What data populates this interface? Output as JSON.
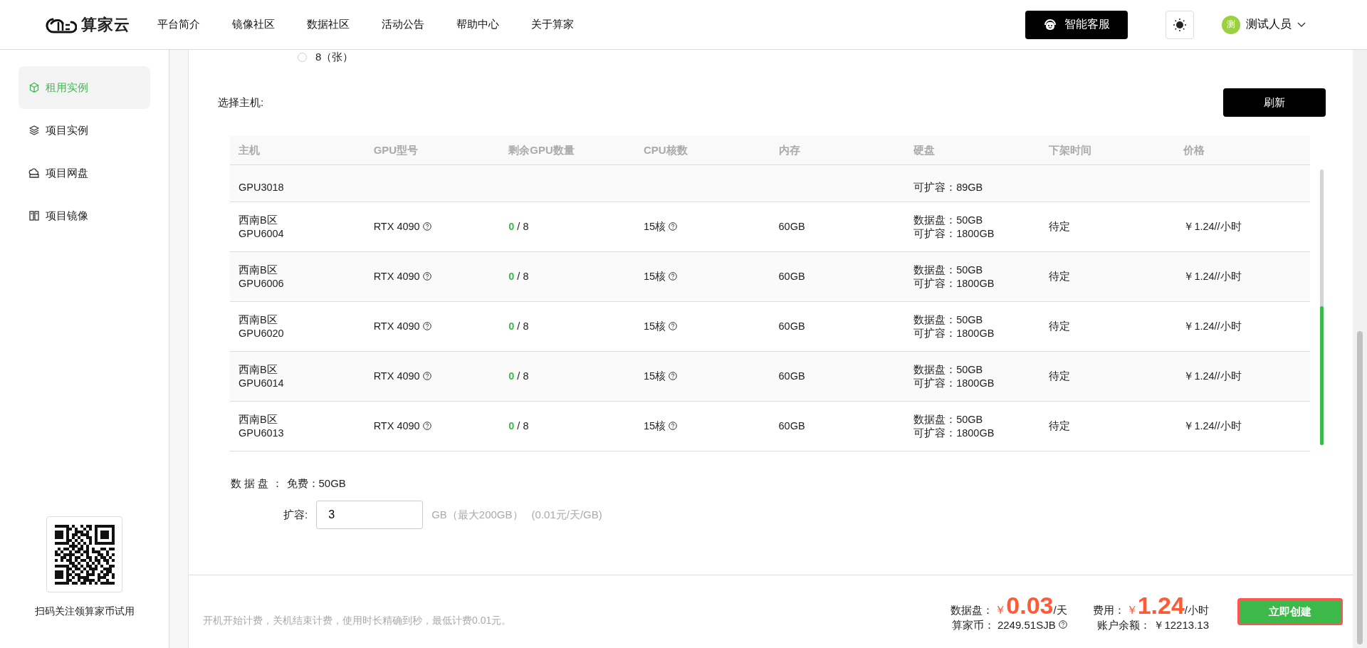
{
  "header": {
    "logo_text": "算家云",
    "nav": [
      {
        "label": "平台简介"
      },
      {
        "label": "镜像社区"
      },
      {
        "label": "数据社区"
      },
      {
        "label": "活动公告"
      },
      {
        "label": "帮助中心"
      },
      {
        "label": "关于算家"
      }
    ],
    "service_button": "智能客服",
    "user": {
      "avatar": "测",
      "name": "测试人员"
    }
  },
  "sidebar": {
    "items": [
      {
        "label": "租用实例",
        "selected": true
      },
      {
        "label": "项目实例",
        "selected": false
      },
      {
        "label": "项目网盘",
        "selected": false
      },
      {
        "label": "项目镜像",
        "selected": false
      }
    ],
    "qr_caption": "扫码关注领算家币试用"
  },
  "gpu_count_option": {
    "label": "8（张）",
    "selected": false
  },
  "host_select": {
    "label": "选择主机:",
    "refresh_button": "刷新",
    "table": {
      "columns": [
        "主机",
        "GPU型号",
        "剩余GPU数量",
        "CPU核数",
        "内存",
        "硬盘",
        "下架时间",
        "价格"
      ],
      "rows": [
        {
          "kind": "partial",
          "host": [
            "GPU3018"
          ],
          "disk": [
            "可扩容：89GB"
          ]
        },
        {
          "kind": "full",
          "host": [
            "西南B区",
            "GPU6004"
          ],
          "gpu": "RTX 4090",
          "free": "0",
          "total": "/ 8",
          "cpu": "15核",
          "mem": "60GB",
          "disk": [
            "数据盘：50GB",
            "可扩容：1800GB"
          ],
          "offline": "待定",
          "price": "￥1.24//小时"
        },
        {
          "kind": "full",
          "host": [
            "西南B区",
            "GPU6006"
          ],
          "gpu": "RTX 4090",
          "free": "0",
          "total": "/ 8",
          "cpu": "15核",
          "mem": "60GB",
          "disk": [
            "数据盘：50GB",
            "可扩容：1800GB"
          ],
          "offline": "待定",
          "price": "￥1.24//小时"
        },
        {
          "kind": "full",
          "host": [
            "西南B区",
            "GPU6020"
          ],
          "gpu": "RTX 4090",
          "free": "0",
          "total": "/ 8",
          "cpu": "15核",
          "mem": "60GB",
          "disk": [
            "数据盘：50GB",
            "可扩容：1800GB"
          ],
          "offline": "待定",
          "price": "￥1.24//小时"
        },
        {
          "kind": "full",
          "host": [
            "西南B区",
            "GPU6014"
          ],
          "gpu": "RTX 4090",
          "free": "0",
          "total": "/ 8",
          "cpu": "15核",
          "mem": "60GB",
          "disk": [
            "数据盘：50GB",
            "可扩容：1800GB"
          ],
          "offline": "待定",
          "price": "￥1.24//小时"
        },
        {
          "kind": "full",
          "host": [
            "西南B区",
            "GPU6013"
          ],
          "gpu": "RTX 4090",
          "free": "0",
          "total": "/ 8",
          "cpu": "15核",
          "mem": "60GB",
          "disk": [
            "数据盘：50GB",
            "可扩容：1800GB"
          ],
          "offline": "待定",
          "price": "￥1.24//小时"
        }
      ]
    }
  },
  "data_disk": {
    "label": "数 据 盘 ：",
    "free": "免费：50GB",
    "expand_label": "扩容:",
    "expand_value": "3",
    "unit_note": "GB（最大200GB）",
    "price_note": "(0.01元/天/GB)"
  },
  "footer": {
    "note": "开机开始计费，关机结束计费，使用时长精确到秒，最低计费0.01元。",
    "disk_label": "数据盘：",
    "disk_currency": "￥",
    "disk_amount": "0.03",
    "disk_unit": "/天",
    "fee_label": "费用：",
    "fee_currency": "￥",
    "fee_amount": "1.24",
    "fee_unit": "/小时",
    "coin_label": "算家币：",
    "coin_value": "2249.51SJB",
    "balance_label": "账户余额：",
    "balance_value": "￥12213.13",
    "create_button": "立即创建"
  }
}
